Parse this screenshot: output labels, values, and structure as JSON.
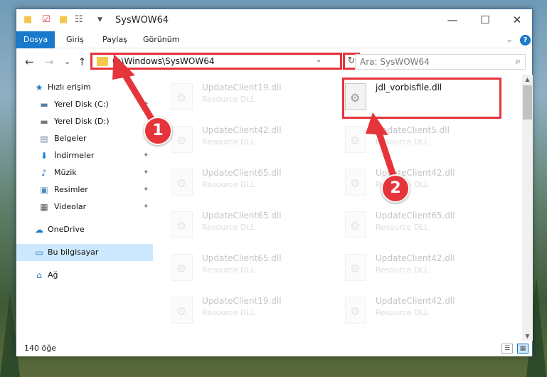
{
  "window": {
    "title": "SysWOW64",
    "minimize_glyph": "—",
    "maximize_glyph": "☐",
    "close_glyph": "✕"
  },
  "ribbon": {
    "tabs": [
      "Dosya",
      "Giriş",
      "Paylaş",
      "Görünüm"
    ],
    "expand_glyph": "⌄",
    "help_glyph": "?"
  },
  "nav": {
    "back_glyph": "←",
    "forward_glyph": "→",
    "recent_glyph": "⌄",
    "up_glyph": "↑"
  },
  "address": {
    "path": "C:\\Windows\\SysWOW64",
    "dropdown_glyph": "⌄",
    "refresh_glyph": "↻"
  },
  "search": {
    "placeholder": "Ara: SysWOW64",
    "icon_glyph": "⌕"
  },
  "sidebar": {
    "items": [
      {
        "label": "Hızlı erişim",
        "icon": "star-icon",
        "glyph": "★",
        "color": "#1979ca"
      },
      {
        "label": "Yerel Disk (C:)",
        "icon": "drive-icon",
        "glyph": "▬",
        "color": "#5a7fa0"
      },
      {
        "label": "Yerel Disk (D:)",
        "icon": "drive-icon",
        "glyph": "▬",
        "color": "#7a7a7a"
      },
      {
        "label": "Belgeler",
        "icon": "document-icon",
        "glyph": "▤",
        "color": "#7a8ea8"
      },
      {
        "label": "İndirmeler",
        "icon": "download-icon",
        "glyph": "⬇",
        "color": "#1979ca"
      },
      {
        "label": "Müzik",
        "icon": "music-icon",
        "glyph": "♪",
        "color": "#1979ca"
      },
      {
        "label": "Resimler",
        "icon": "pictures-icon",
        "glyph": "▣",
        "color": "#4a8ab8"
      },
      {
        "label": "Videolar",
        "icon": "video-icon",
        "glyph": "▦",
        "color": "#555"
      },
      {
        "label": "OneDrive",
        "icon": "cloud-icon",
        "glyph": "☁",
        "color": "#1979ca"
      },
      {
        "label": "Bu bilgisayar",
        "icon": "computer-icon",
        "glyph": "▭",
        "color": "#1979ca"
      },
      {
        "label": "Ağ",
        "icon": "network-icon",
        "glyph": "⌂",
        "color": "#1979ca"
      }
    ],
    "pin_glyph": "📌"
  },
  "files": {
    "left_column": [
      {
        "name": "UpdateClient19.dll",
        "type": "Resource DLL"
      },
      {
        "name": "UpdateClient42.dll",
        "type": "Resource DLL"
      },
      {
        "name": "UpdateClient65.dll",
        "type": "Resource DLL"
      },
      {
        "name": "UpdateClient65.dll",
        "type": "Resource DLL"
      },
      {
        "name": "UpdateClient65.dll",
        "type": "Resource DLL"
      },
      {
        "name": "UpdateClient19.dll",
        "type": "Resource DLL"
      }
    ],
    "right_column": [
      {
        "name": "jdl_vorbisfile.dll",
        "type": ""
      },
      {
        "name": "UpdateClient5.dll",
        "type": "Resource DLL"
      },
      {
        "name": "UpdateClient42.dll",
        "type": "Resource DLL"
      },
      {
        "name": "UpdateClient65.dll",
        "type": "Resource DLL"
      },
      {
        "name": "UpdateClient42.dll",
        "type": "Resource DLL"
      },
      {
        "name": "UpdateClient42.dll",
        "type": "Resource DLL"
      }
    ]
  },
  "status": {
    "count": "140 öğe"
  },
  "annotations": {
    "badge_1": "1",
    "badge_2": "2",
    "color": "#e5343a"
  },
  "colors": {
    "accent": "#1979ca",
    "selection": "#cce8ff",
    "highlight": "#e5343a"
  }
}
